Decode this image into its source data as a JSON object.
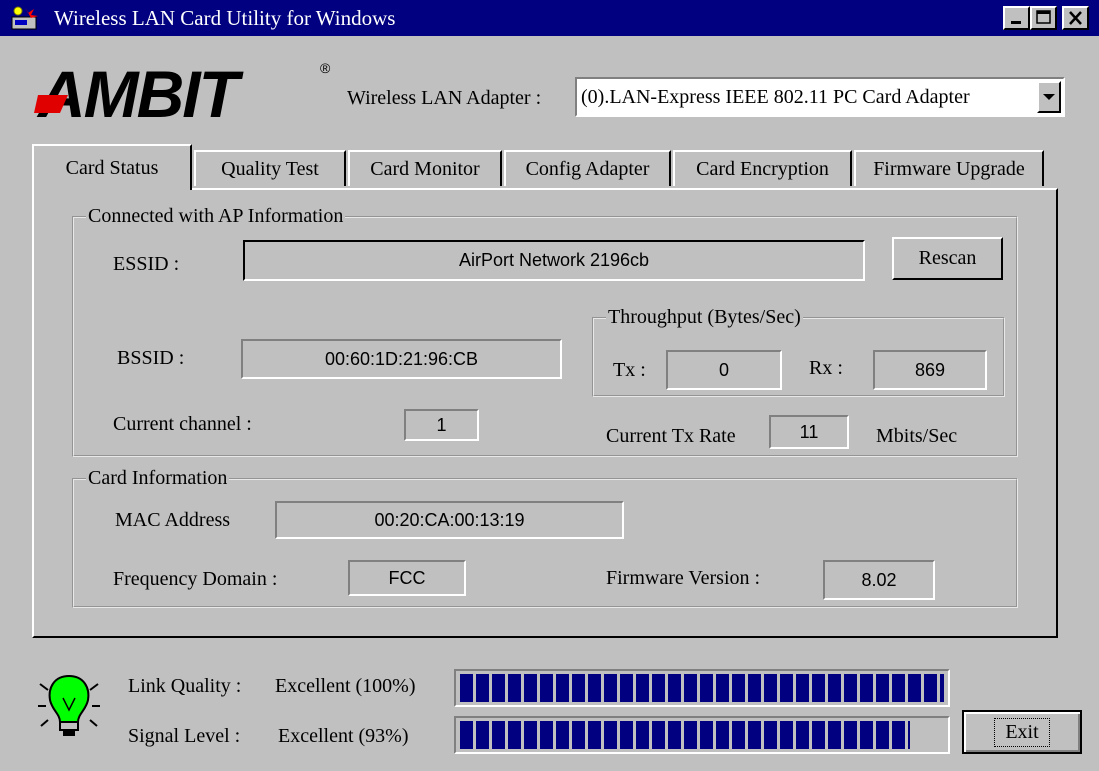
{
  "window": {
    "title": "Wireless LAN Card Utility for Windows",
    "title_bar_color": "#000080"
  },
  "brand": {
    "logo_text": "AMBIT",
    "registered_mark": "®"
  },
  "adapter": {
    "label": "Wireless LAN Adapter :",
    "selected": "(0).LAN-Express IEEE 802.11 PC Card Adapter"
  },
  "tabs": [
    {
      "label": "Card Status",
      "active": true
    },
    {
      "label": "Quality Test"
    },
    {
      "label": "Card Monitor"
    },
    {
      "label": "Config Adapter"
    },
    {
      "label": "Card Encryption"
    },
    {
      "label": "Firmware Upgrade"
    }
  ],
  "ap_info": {
    "group_title": "Connected with AP Information",
    "essid_label": "ESSID :",
    "essid_value": "AirPort Network 2196cb",
    "rescan_label": "Rescan",
    "bssid_label": "BSSID :",
    "bssid_value": "00:60:1D:21:96:CB",
    "channel_label": "Current channel :",
    "channel_value": "1",
    "throughput": {
      "group_title": "Throughput (Bytes/Sec)",
      "tx_label": "Tx :",
      "tx_value": "0",
      "rx_label": "Rx :",
      "rx_value": "869"
    },
    "tx_rate_label": "Current Tx Rate",
    "tx_rate_value": "11",
    "tx_rate_unit": "Mbits/Sec"
  },
  "card_info": {
    "group_title": "Card Information",
    "mac_label": "MAC Address",
    "mac_value": "00:20:CA:00:13:19",
    "freq_label": "Frequency Domain :",
    "freq_value": "FCC",
    "fw_label": "Firmware Version :",
    "fw_value": "8.02"
  },
  "status": {
    "indicator_icon": "lightbulb-icon",
    "indicator_color": "#00ff00",
    "link_quality_label": "Link Quality :",
    "link_quality_value": "Excellent (100%)",
    "link_quality_level": 1.0,
    "signal_level_label": "Signal Level :",
    "signal_level_value": "Excellent (93%)",
    "signal_level_level": 0.93,
    "bar_color": "#000080"
  },
  "exit_label": "Exit"
}
